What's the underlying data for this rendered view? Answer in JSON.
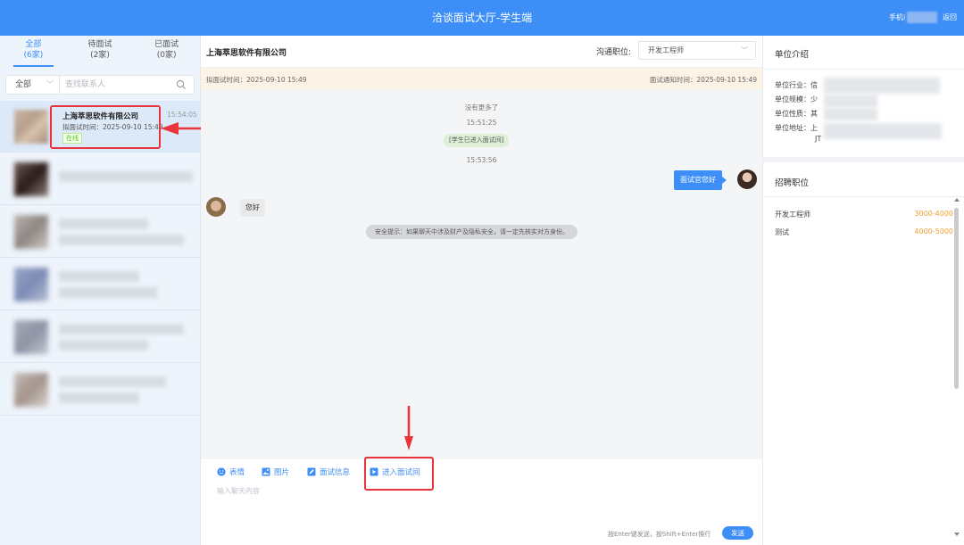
{
  "header": {
    "title": "洽谈面试大厅-学生端",
    "phone_label": "手机i",
    "back_label": "返回"
  },
  "tabs": [
    {
      "label": "全部",
      "count": "(6家)"
    },
    {
      "label": "待面试",
      "count": "(2家)"
    },
    {
      "label": "已面试",
      "count": "(0家)"
    }
  ],
  "filter": {
    "selected": "全部",
    "placeholder": "查找联系人"
  },
  "contact_active": {
    "name": "上海萃思软件有限公司",
    "time": "15:54:05",
    "subtitle": "拟面试时间：2025-09-10 15:49",
    "status": "在线"
  },
  "chat": {
    "company": "上海萃思软件有限公司",
    "position_label": "沟通职位:",
    "position_selected": "开发工程师",
    "planned_time": "拟面试时间：2025-09-10 15:49",
    "notice_time": "面试通知时间：2025-09-10 15:49",
    "no_more": "没有更多了",
    "time1": "15:51:25",
    "system_msg": "[学生已进入面试间]",
    "time2": "15:53:56",
    "msg_out": "面试官您好",
    "msg_in": "您好",
    "safety": "安全提示：如果聊天中涉及财产及隐私安全，请一定先核实对方身份。"
  },
  "toolbar": {
    "emoji": "表情",
    "image": "图片",
    "interview_info": "面试信息",
    "enter_room": "进入面试间"
  },
  "composer": {
    "placeholder": "输入聊天内容",
    "hint": "按Enter键发送，按Shift+Enter换行",
    "send": "发送"
  },
  "company_info": {
    "title": "单位介绍",
    "rows": [
      {
        "label": "单位行业：",
        "value": "信"
      },
      {
        "label": "单位规模：",
        "value": "少"
      },
      {
        "label": "单位性质：",
        "value": "其"
      },
      {
        "label": "单位地址：",
        "value": "上"
      }
    ],
    "address_extra": "JT"
  },
  "jobs": {
    "title": "招聘职位",
    "items": [
      {
        "name": "开发工程师",
        "salary": "3000-4000"
      },
      {
        "name": "测试",
        "salary": "4000-5000"
      }
    ]
  },
  "colors": {
    "primary": "#3d8ef7",
    "highlight": "#e8343a",
    "salary": "#f0a030",
    "online": "#52c41a"
  }
}
